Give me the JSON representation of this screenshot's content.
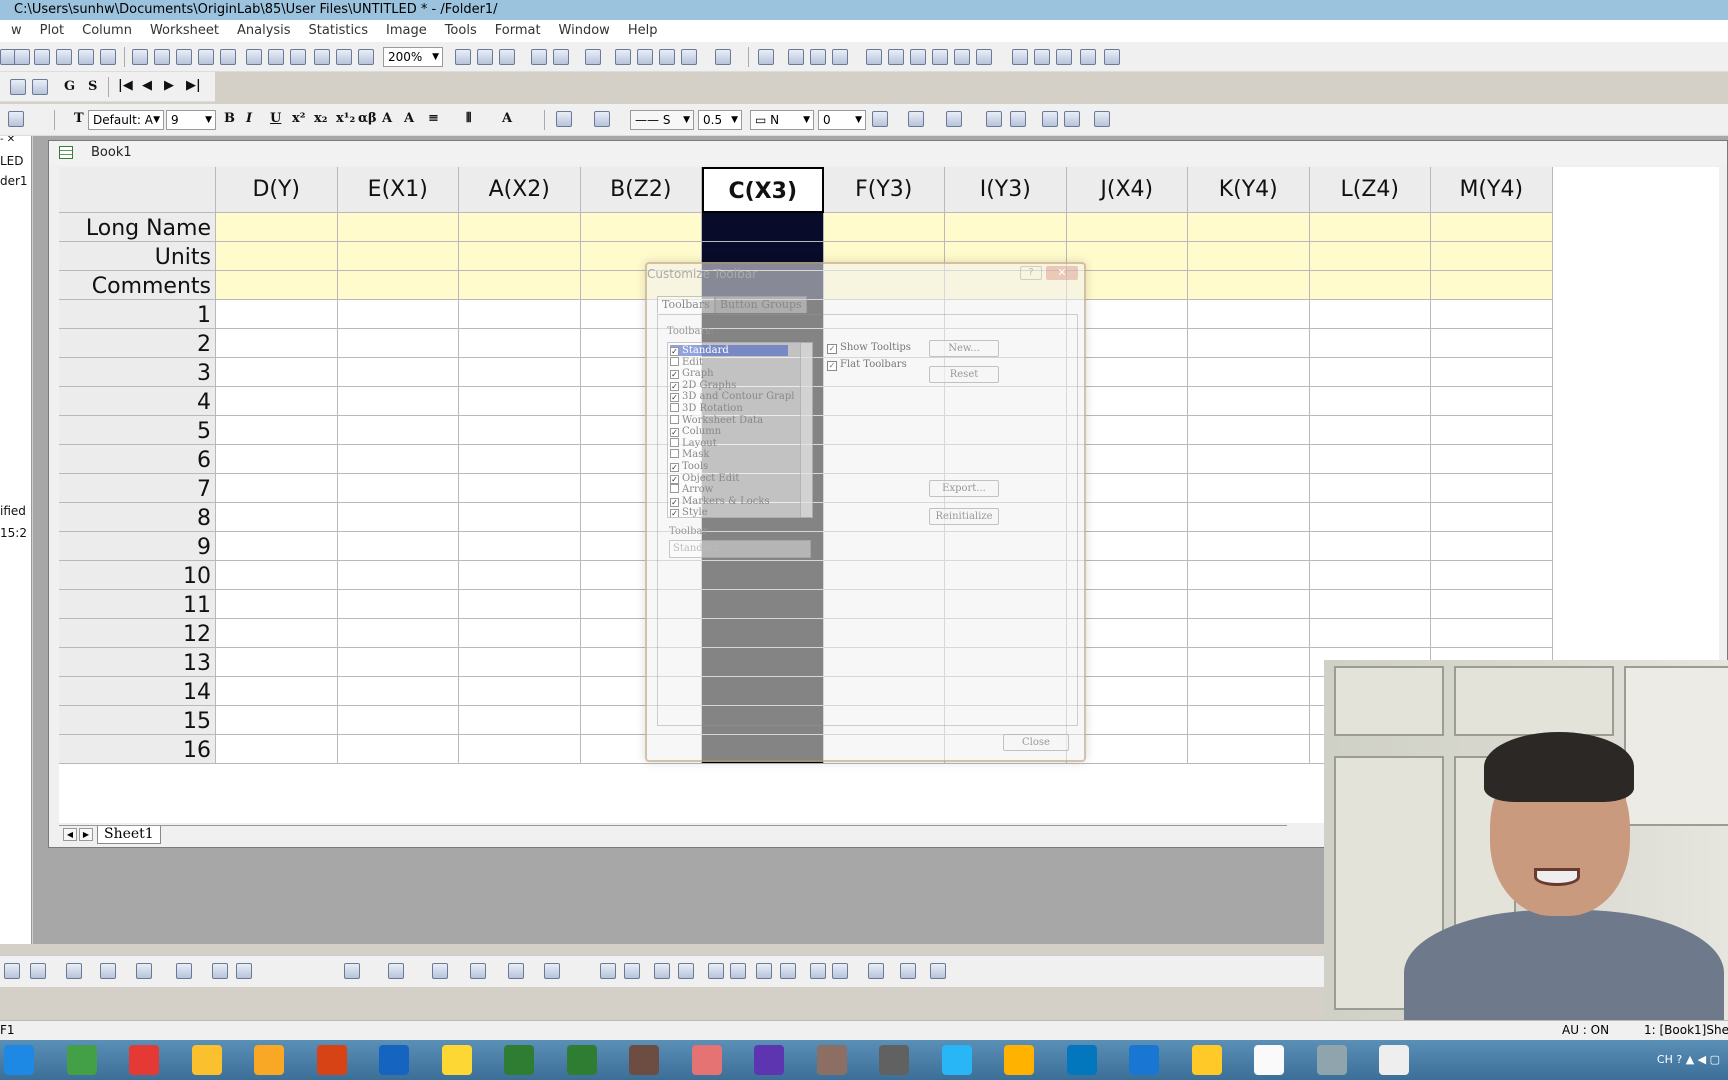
{
  "window": {
    "title": "C:\\Users\\sunhw\\Documents\\OriginLab\\85\\User Files\\UNTITLED * - /Folder1/"
  },
  "menu": [
    "w",
    "Plot",
    "Column",
    "Worksheet",
    "Analysis",
    "Statistics",
    "Image",
    "Tools",
    "Format",
    "Window",
    "Help"
  ],
  "toolbar": {
    "zoom": "200%",
    "text_buttons": [
      "G",
      "S"
    ],
    "font": "Default: A",
    "font_size": "9",
    "format_buttons": [
      "B",
      "I",
      "U"
    ],
    "line_label": "S",
    "line_width": "0.5",
    "n_label": "N",
    "n_value": "0"
  },
  "left_panel": {
    "items": [
      "LED",
      "der1",
      "ified",
      "15:2"
    ]
  },
  "book": {
    "title": "Book1",
    "columns": [
      "D(Y)",
      "E(X1)",
      "A(X2)",
      "B(Z2)",
      "C(X3)",
      "F(Y3)",
      "I(Y3)",
      "J(X4)",
      "K(Y4)",
      "L(Z4)",
      "M(Y4)"
    ],
    "selected_column": "C(X3)",
    "meta_rows": [
      "Long Name",
      "Units",
      "Comments"
    ],
    "rows": [
      "1",
      "2",
      "3",
      "4",
      "5",
      "6",
      "7",
      "8",
      "9",
      "10",
      "11",
      "12",
      "13",
      "14",
      "15",
      "16"
    ],
    "sheet_tab": "Sheet1"
  },
  "dialog": {
    "title": "Customize Toolbar",
    "help": "?",
    "tabs": [
      "Toolbars",
      "Button Groups"
    ],
    "list_label": "Toolbars:",
    "items": [
      {
        "label": "Standard",
        "checked": "✓"
      },
      {
        "label": "Edit",
        "checked": ""
      },
      {
        "label": "Graph",
        "checked": "✓"
      },
      {
        "label": "2D Graphs",
        "checked": "✓"
      },
      {
        "label": "3D and Contour Grapl",
        "checked": "✓"
      },
      {
        "label": "3D Rotation",
        "checked": ""
      },
      {
        "label": "Worksheet Data",
        "checked": ""
      },
      {
        "label": "Column",
        "checked": "✓"
      },
      {
        "label": "Layout",
        "checked": ""
      },
      {
        "label": "Mask",
        "checked": ""
      },
      {
        "label": "Tools",
        "checked": "✓"
      },
      {
        "label": "Object Edit",
        "checked": "✓"
      },
      {
        "label": "Arrow",
        "checked": ""
      },
      {
        "label": "Markers & Locks",
        "checked": "✓"
      },
      {
        "label": "Style",
        "checked": "✓"
      }
    ],
    "show_tooltips": "Show Tooltips",
    "flat_toolbars": "Flat Toolbars",
    "buttons": {
      "new": "New...",
      "reset": "Reset",
      "export": "Export...",
      "reinitialize": "Reinitialize",
      "close": "Close"
    },
    "name_label": "Toolbar",
    "name_value": "Standard"
  },
  "status": {
    "left": "F1",
    "au": "AU : ON",
    "right": "1: [Book1]Shee"
  },
  "taskbar": {
    "lang": "CH"
  },
  "colors": {
    "selected_column": "#080c2a",
    "meta_row": "#fffbcc",
    "title_bar": "#9cc3dd",
    "taskbar": "#3c6f98"
  }
}
